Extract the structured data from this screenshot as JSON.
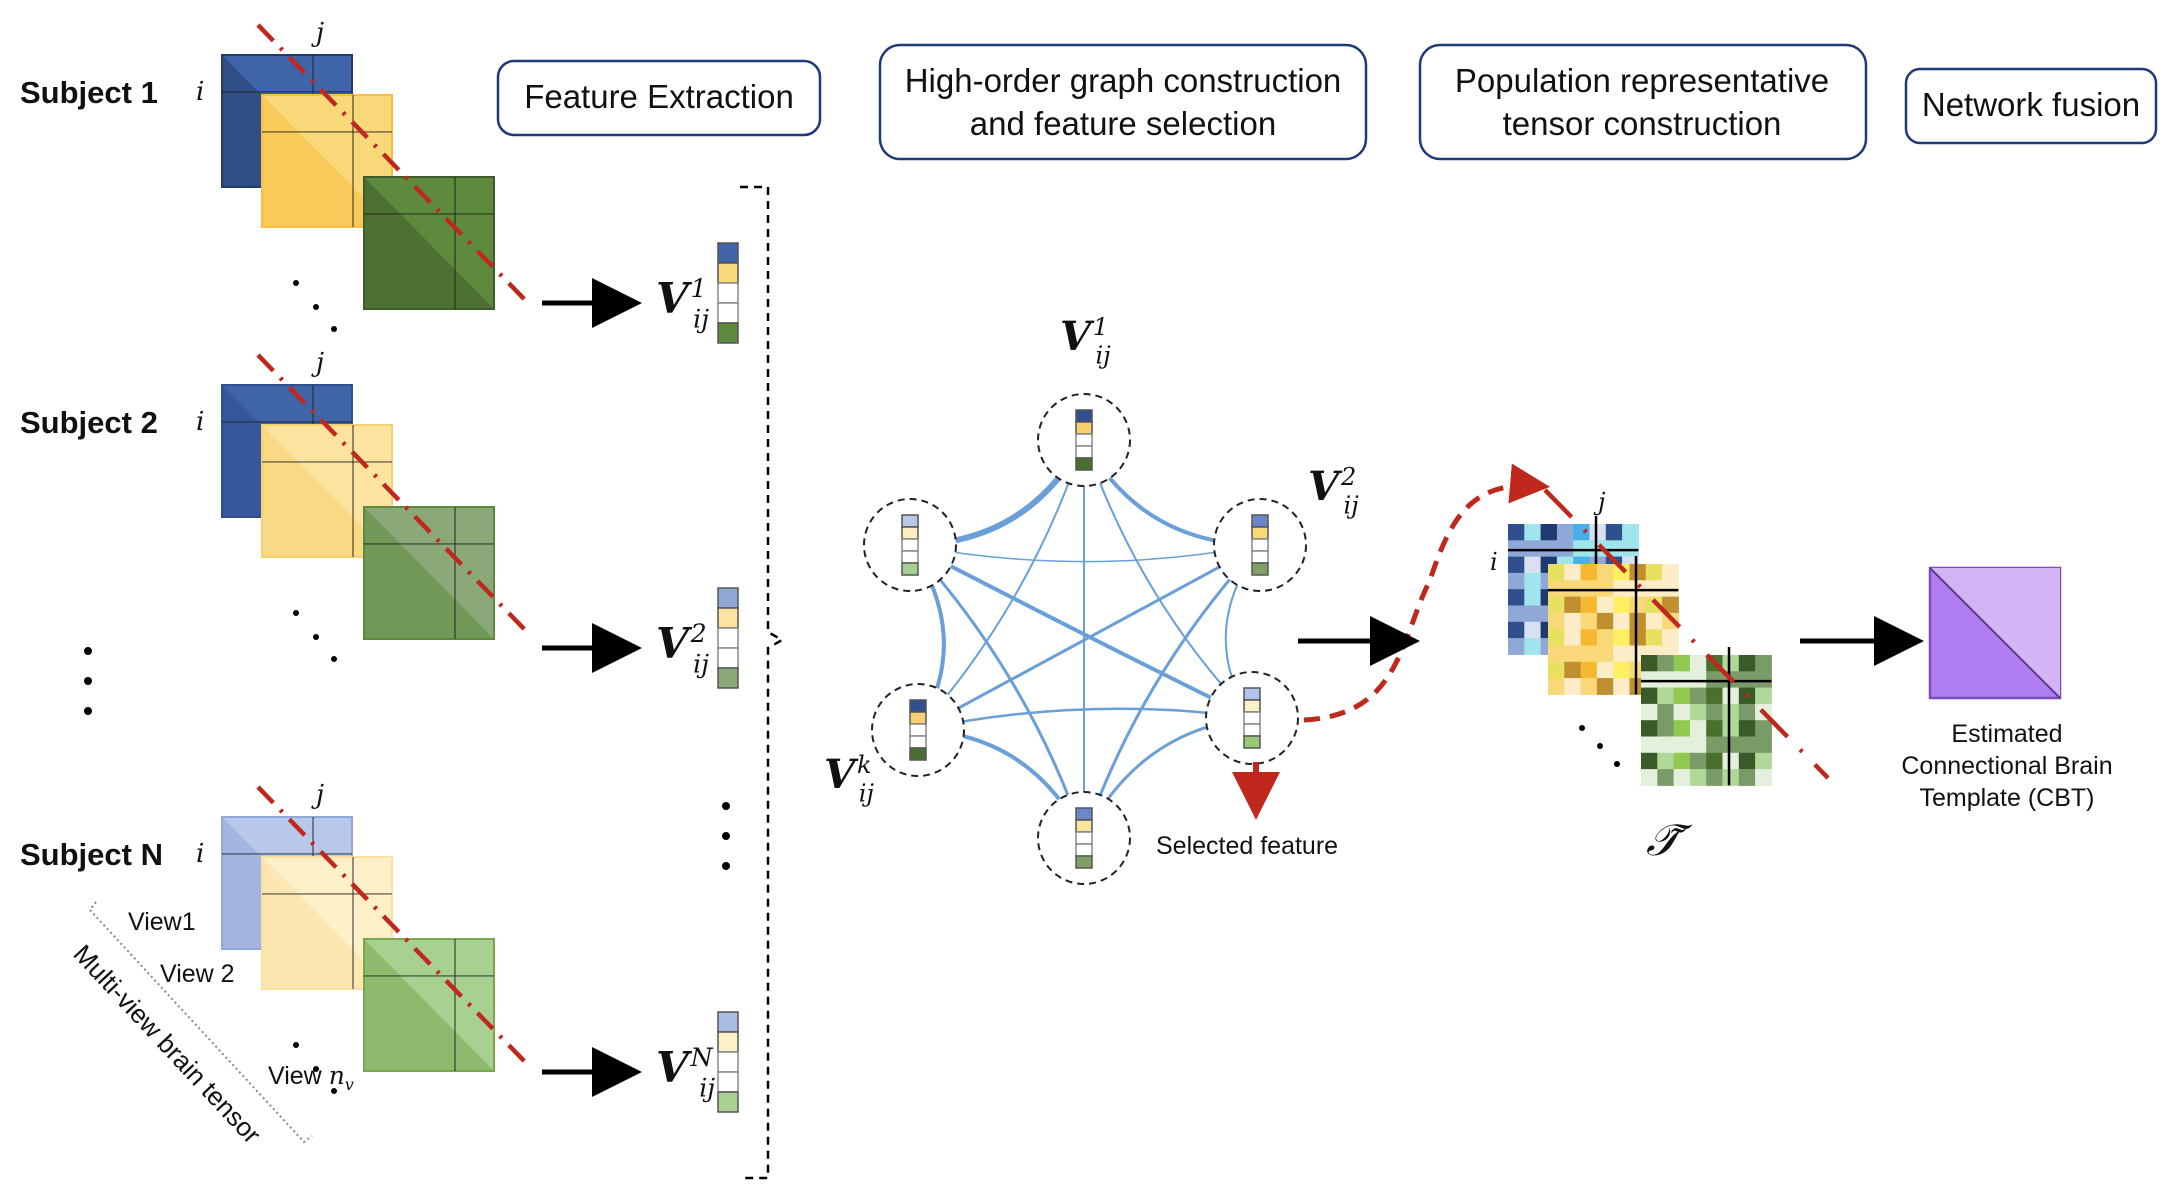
{
  "stages": [
    {
      "label": "Feature Extraction"
    },
    {
      "line1": "High-order graph construction",
      "line2": "and feature selection"
    },
    {
      "line1": "Population representative",
      "line2": "tensor construction"
    },
    {
      "label": "Network fusion"
    }
  ],
  "subjects": [
    "Subject 1",
    "Subject 2",
    "Subject N"
  ],
  "index_i": "i",
  "index_j": "j",
  "views": {
    "view1": "View1",
    "view2": "View 2",
    "viewn": "View ",
    "viewn_math": "n",
    "viewn_sub": "v"
  },
  "tensor_caption": "Multi-view brain tensor",
  "feature_vectors": [
    {
      "base": "V",
      "sub": "ij",
      "sup": "1"
    },
    {
      "base": "V",
      "sub": "ij",
      "sup": "2"
    },
    {
      "base": "V",
      "sub": "ij",
      "sup": "N"
    }
  ],
  "graph_labels": [
    {
      "base": "V",
      "sub": "ij",
      "sup": "1"
    },
    {
      "base": "V",
      "sub": "ij",
      "sup": "2"
    },
    {
      "base": "V",
      "sub": "ij",
      "sup": "k"
    }
  ],
  "selected_feature": "Selected feature",
  "population_tensor_symbol": "𝒯̃",
  "cbt": {
    "line1": "Estimated",
    "line2": "Connectional Brain",
    "line3": "Template (CBT)"
  },
  "colors": {
    "view1_dark": "#2f4f8f",
    "view1_mid": "#3f64a8",
    "view1_light": "#8fa8d8",
    "view2": "#f5c040",
    "view2_light": "#fbe3a0",
    "view3_dark": "#4a7030",
    "view3_light": "#80b060",
    "diag_red": "#c0281e",
    "edge_blue": "#6a9fd8",
    "cbt_purple": "#b07ef0",
    "stage_border": "#1f3a78"
  }
}
